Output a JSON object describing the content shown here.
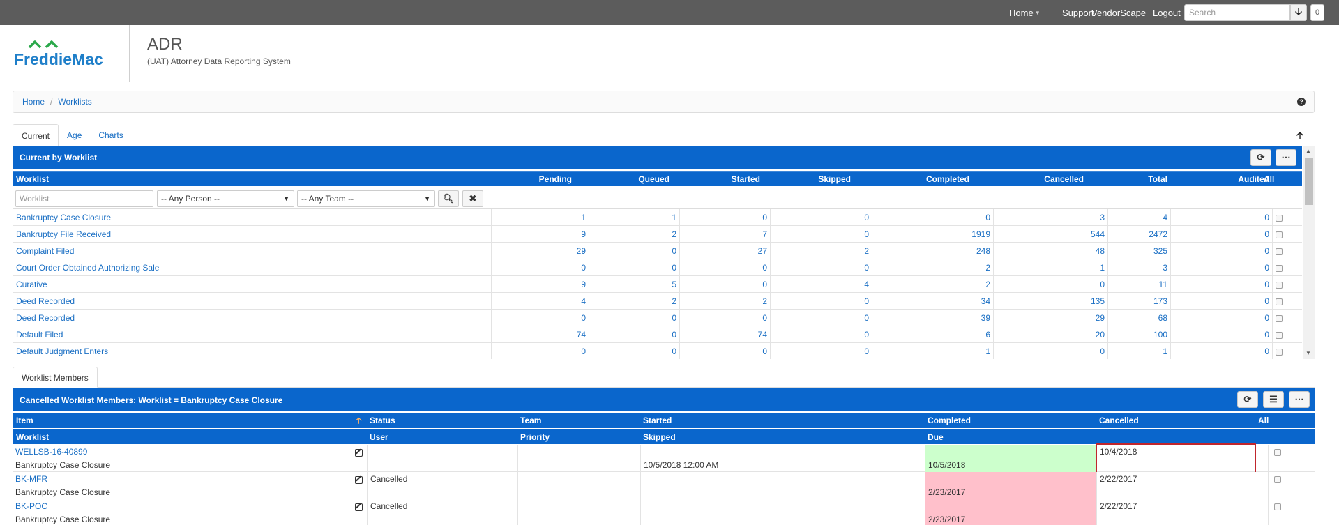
{
  "topnav": {
    "home": "Home",
    "support": "Support",
    "vendorscape": "VendorScape",
    "logout": "Logout",
    "search_placeholder": "Search",
    "count": "0"
  },
  "header": {
    "logo_text": "FreddieMac",
    "title": "ADR",
    "subtitle": "(UAT) Attorney Data Reporting System"
  },
  "breadcrumb": {
    "home": "Home",
    "separator": "/",
    "current": "Worklists"
  },
  "tabs": [
    "Current",
    "Age",
    "Charts"
  ],
  "worklist_panel": {
    "title": "Current by Worklist",
    "columns": [
      "Worklist",
      "Pending",
      "Queued",
      "Started",
      "Skipped",
      "Completed",
      "Cancelled",
      "Total",
      "Audited",
      "All"
    ],
    "filter": {
      "worklist_placeholder": "Worklist",
      "person": "-- Any Person --",
      "team": "-- Any Team --"
    },
    "rows": [
      {
        "name": "Bankruptcy Case Closure",
        "values": [
          "1",
          "1",
          "0",
          "0",
          "0",
          "3",
          "4",
          "0"
        ]
      },
      {
        "name": "Bankruptcy File Received",
        "values": [
          "9",
          "2",
          "7",
          "0",
          "1919",
          "544",
          "2472",
          "0"
        ]
      },
      {
        "name": "Complaint Filed",
        "values": [
          "29",
          "0",
          "27",
          "2",
          "248",
          "48",
          "325",
          "0"
        ]
      },
      {
        "name": "Court Order Obtained Authorizing Sale",
        "values": [
          "0",
          "0",
          "0",
          "0",
          "2",
          "1",
          "3",
          "0"
        ]
      },
      {
        "name": "Curative",
        "values": [
          "9",
          "5",
          "0",
          "4",
          "2",
          "0",
          "11",
          "0"
        ]
      },
      {
        "name": "Deed Recorded",
        "values": [
          "4",
          "2",
          "2",
          "0",
          "34",
          "135",
          "173",
          "0"
        ]
      },
      {
        "name": "Deed Recorded",
        "values": [
          "0",
          "0",
          "0",
          "0",
          "39",
          "29",
          "68",
          "0"
        ]
      },
      {
        "name": "Default Filed",
        "values": [
          "74",
          "0",
          "74",
          "0",
          "6",
          "20",
          "100",
          "0"
        ]
      },
      {
        "name": "Default Judgment Enters",
        "values": [
          "0",
          "0",
          "0",
          "0",
          "1",
          "0",
          "1",
          "0"
        ]
      }
    ]
  },
  "members_tab": "Worklist Members",
  "members_panel": {
    "title": "Cancelled Worklist Members: Worklist = Bankruptcy Case Closure",
    "head1": [
      "Item",
      "Status",
      "Team",
      "Started",
      "Completed",
      "Cancelled",
      "All"
    ],
    "head2": [
      "Worklist",
      "User",
      "Priority",
      "Skipped",
      "Due"
    ],
    "rows": [
      {
        "item": "WELLSB-16-40899",
        "worklist": "Bankruptcy Case Closure",
        "status": "",
        "skipped": "10/5/2018 12:00 AM",
        "due": "10/5/2018",
        "cancelled": "10/4/2018"
      },
      {
        "item": "BK-MFR",
        "worklist": "Bankruptcy Case Closure",
        "status": "Cancelled",
        "skipped": "",
        "due": "2/23/2017",
        "cancelled": "2/22/2017"
      },
      {
        "item": "BK-POC",
        "worklist": "Bankruptcy Case Closure",
        "status": "Cancelled",
        "skipped": "",
        "due": "2/23/2017",
        "cancelled": "2/22/2017"
      }
    ]
  },
  "colors": {
    "topbar": "#5c5c5c",
    "panel_blue": "#0a66cc",
    "link": "#1a6fc4",
    "due_ok": "#ccffcc",
    "due_late": "#ffc0cb",
    "highlight": "#c0262d"
  }
}
